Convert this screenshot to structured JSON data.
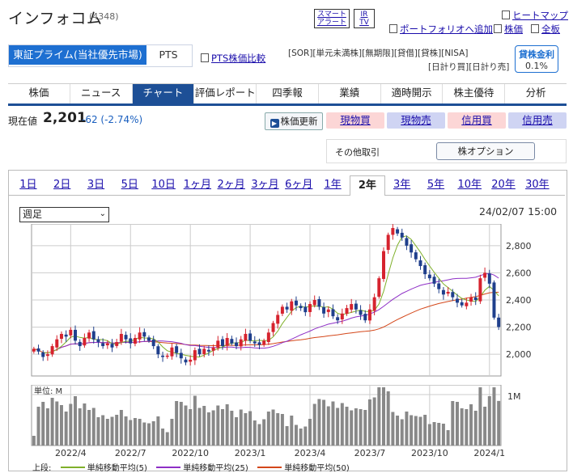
{
  "header": {
    "company": "インフォコム",
    "code": "(4348)",
    "smart_alert": "スマート\nアラート",
    "irtv": "IR\nTV",
    "heatmap": "ヒートマップ",
    "portfolio": "ポートフォリオへ追加",
    "stock": "株価",
    "all": "全板"
  },
  "market": {
    "active": "東証プライム(当社優先市場)",
    "pts": "PTS",
    "pts_compare": "PTS株価比較",
    "tags": [
      "[SOR]",
      "[単元未満株]",
      "[無期限]",
      "[貸借]",
      "[貸株]",
      "[NISA]"
    ],
    "tags2": [
      "[日計り買]",
      "[日計り売]"
    ],
    "lending_label": "貸株金利",
    "lending_rate": "0.1%"
  },
  "nav": [
    "株価",
    "ニュース",
    "チャート",
    "評価レポート",
    "四季報",
    "業績",
    "適時開示",
    "株主優待",
    "分析"
  ],
  "nav_active": "チャート",
  "quote": {
    "label": "現在値",
    "price": "2,201",
    "change": "-62 (-2.74%)",
    "refresh": "株価更新",
    "buy": "現物買",
    "sell": "現物売",
    "margin_buy": "信用買",
    "margin_sell": "信用売"
  },
  "other": {
    "label": "その他取引",
    "option": "株オプション"
  },
  "periods": [
    "1日",
    "2日",
    "3日",
    "5日",
    "10日",
    "1ヶ月",
    "2ヶ月",
    "3ヶ月",
    "6ヶ月",
    "1年",
    "2年",
    "3年",
    "5年",
    "10年",
    "20年",
    "30年"
  ],
  "period_active": "2年",
  "interval_select": "週足",
  "asof": "24/02/07 15:00",
  "colors": {
    "up": "#d6232e",
    "down": "#1f3f8c",
    "ma5": "#7fb02a",
    "ma25": "#8e2fc6",
    "ma50": "#d4471a",
    "brand": "#1d6fd1"
  },
  "chart_data": {
    "type": "candlestick",
    "interval": "weekly",
    "y_ticks": [
      "2,800",
      "2,600",
      "2,400",
      "2,200",
      "2,000"
    ],
    "ylim": [
      1840,
      2960
    ],
    "x_ticks": [
      "2022/4",
      "2022/7",
      "2022/10",
      "2023/1",
      "2023/4",
      "2023/7",
      "2023/10",
      "2024/1"
    ],
    "x_tick_week": [
      8,
      21,
      34,
      47,
      60,
      73,
      86,
      99
    ],
    "volume_unit": "単位: M",
    "volume_tick": "1M",
    "close": [
      2040,
      2020,
      1980,
      2000,
      2060,
      2110,
      2150,
      2130,
      2180,
      2100,
      2060,
      2120,
      2160,
      2110,
      2090,
      2060,
      2080,
      2050,
      2090,
      2150,
      2110,
      2080,
      2120,
      2160,
      2130,
      2100,
      2060,
      2000,
      1980,
      1990,
      2050,
      2010,
      1970,
      1940,
      1960,
      2030,
      2000,
      2040,
      2020,
      2050,
      2100,
      2060,
      2120,
      2080,
      2060,
      2110,
      2150,
      2100,
      2080,
      2070,
      2100,
      2160,
      2230,
      2290,
      2350,
      2330,
      2390,
      2360,
      2340,
      2310,
      2370,
      2400,
      2350,
      2300,
      2330,
      2280,
      2250,
      2300,
      2340,
      2370,
      2330,
      2290,
      2250,
      2330,
      2420,
      2560,
      2760,
      2880,
      2930,
      2890,
      2860,
      2800,
      2750,
      2700,
      2650,
      2590,
      2560,
      2520,
      2480,
      2440,
      2460,
      2420,
      2380,
      2360,
      2380,
      2420,
      2400,
      2560,
      2600,
      2520,
      2270,
      2201
    ],
    "series": [
      {
        "name": "単純移動平均(5)",
        "period": 5
      },
      {
        "name": "単純移動平均(25)",
        "period": 25
      },
      {
        "name": "単純移動平均(50)",
        "period": 50
      }
    ],
    "legend_label": "上段:"
  }
}
